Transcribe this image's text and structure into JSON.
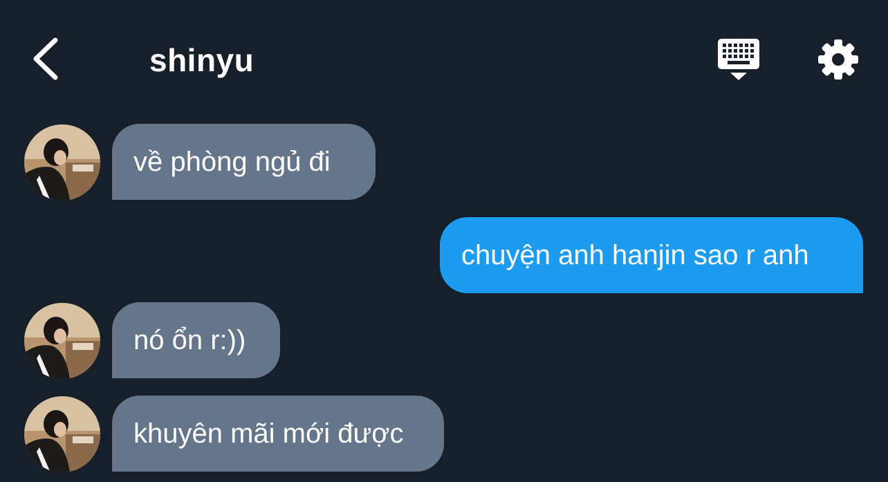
{
  "header": {
    "title": "shinyu",
    "icons": {
      "back": "chevron-left-icon",
      "keyboard": "keyboard-icon",
      "settings": "gear-icon"
    }
  },
  "colors": {
    "background": "#17202a",
    "incoming_bubble": "#66768a",
    "outgoing_bubble": "#1d9bf0",
    "text": "#ffffff"
  },
  "messages": [
    {
      "direction": "incoming",
      "text": "về phòng ngủ đi"
    },
    {
      "direction": "outgoing",
      "text": "chuyện anh hanjin sao r anh"
    },
    {
      "direction": "incoming",
      "text": "nó ổn r:))"
    },
    {
      "direction": "incoming",
      "text": "khuyên mãi mới được"
    }
  ]
}
